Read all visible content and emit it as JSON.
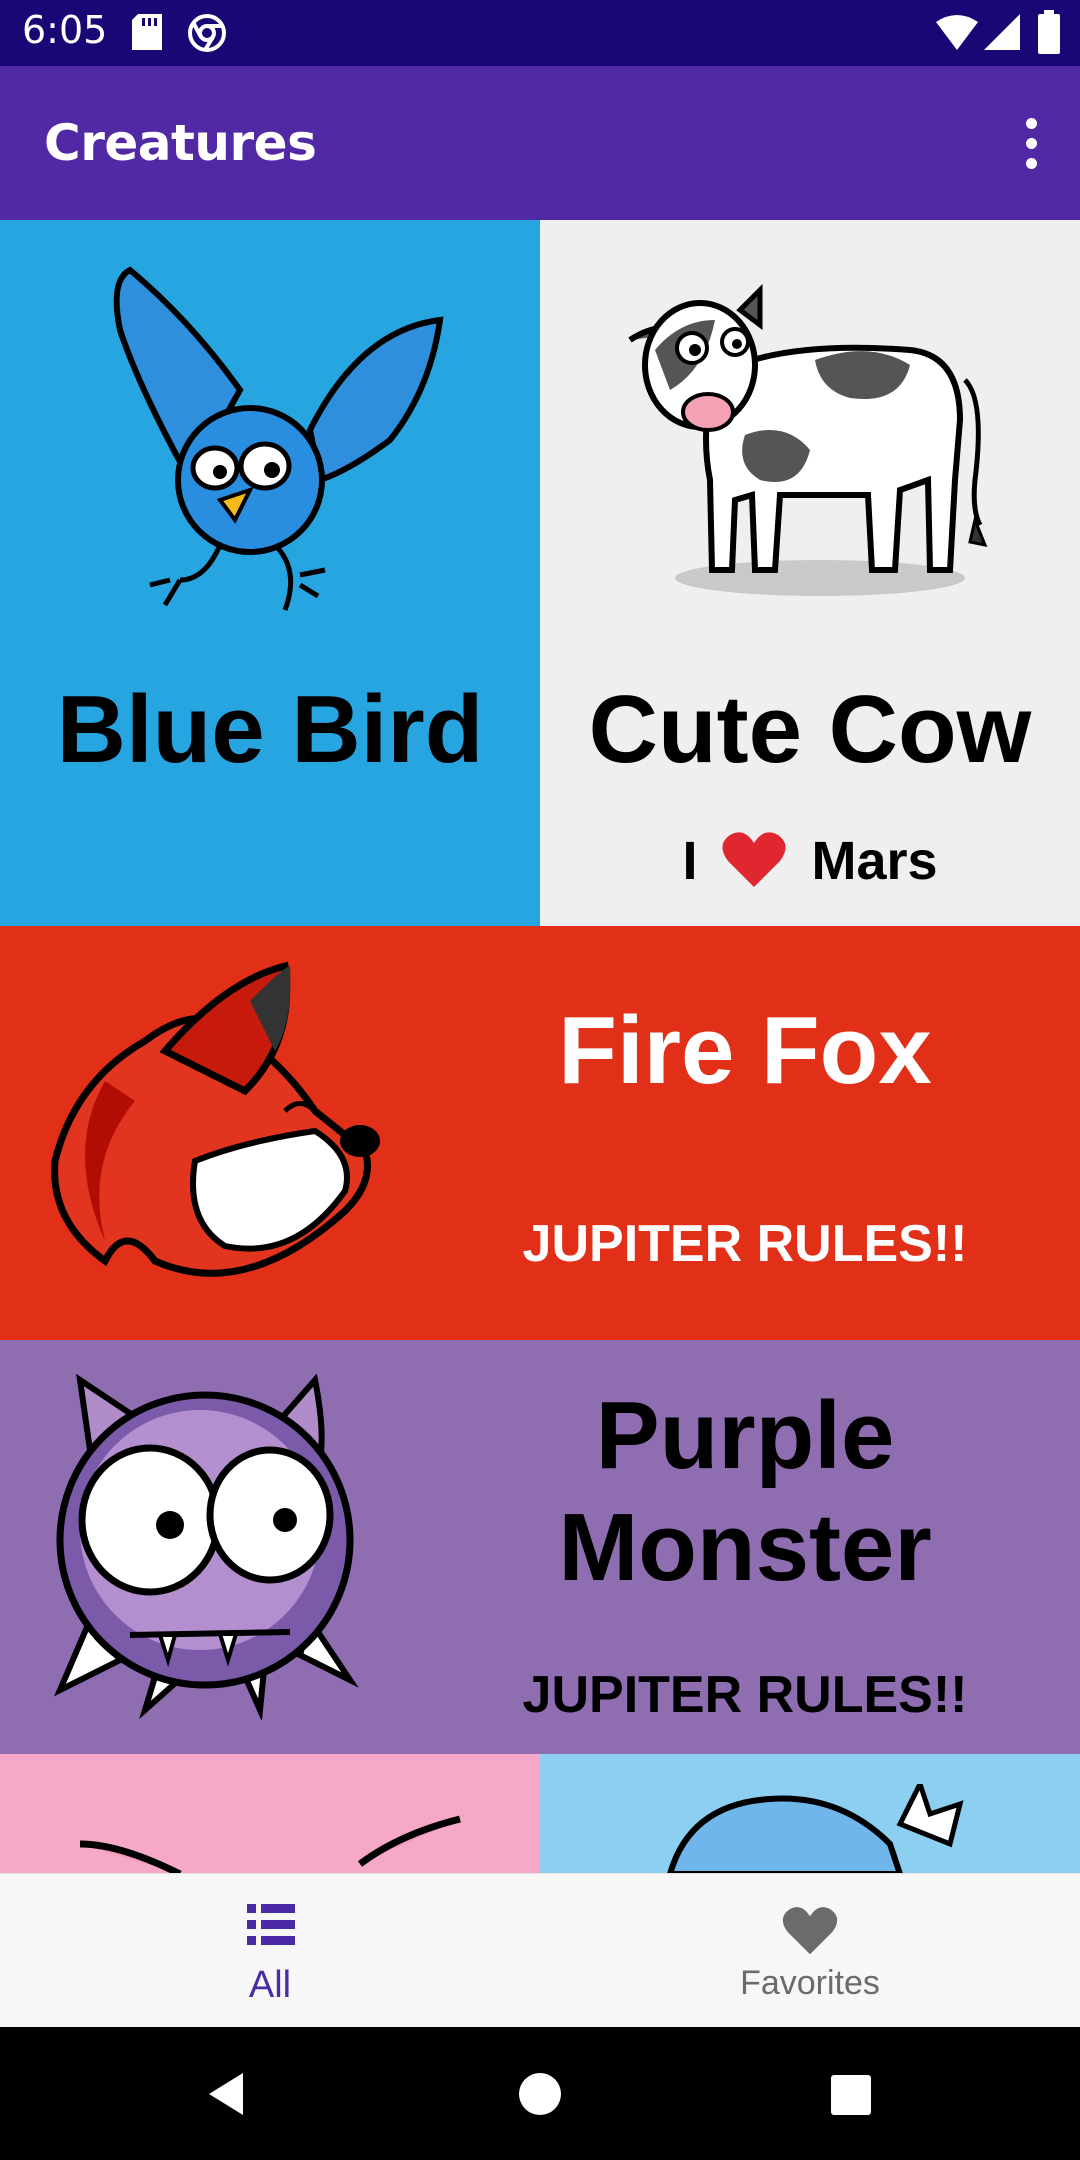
{
  "status_bar": {
    "time": "6:05"
  },
  "app_bar": {
    "title": "Creatures"
  },
  "creatures": {
    "blue_bird": {
      "name": "Blue Bird",
      "color": "#27a5e1"
    },
    "cute_cow": {
      "name": "Cute Cow",
      "subtitle_pre": "I",
      "subtitle_post": "Mars",
      "color": "#efefef"
    },
    "fire_fox": {
      "name": "Fire Fox",
      "subtitle": "JUPITER RULES!!",
      "color": "#e13017"
    },
    "purple_monster": {
      "name_line1": "Purple",
      "name_line2": "Monster",
      "subtitle": "JUPITER RULES!!",
      "color": "#8e6eb1"
    },
    "pink_tile": {
      "color": "#f5a8c8"
    },
    "light_blue_tile": {
      "color": "#8ccff0"
    }
  },
  "bottom_nav": {
    "all": {
      "label": "All",
      "icon": "list-icon",
      "active_color": "#4a2aa6"
    },
    "favorites": {
      "label": "Favorites",
      "icon": "heart-icon"
    }
  },
  "system_nav": {
    "icons": [
      "back-icon",
      "home-icon",
      "recents-icon"
    ]
  }
}
